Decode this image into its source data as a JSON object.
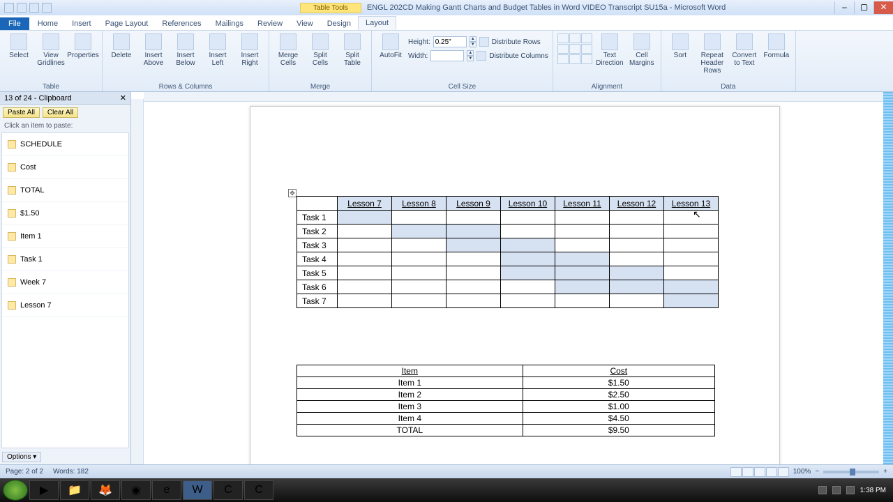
{
  "window": {
    "table_tools": "Table Tools",
    "title": "ENGL 202CD Making Gantt Charts and Budget Tables in Word VIDEO Transcript SU15a - Microsoft Word",
    "min": "–",
    "max": "▢",
    "close": "✕"
  },
  "tabs": {
    "file": "File",
    "items": [
      "Home",
      "Insert",
      "Page Layout",
      "References",
      "Mailings",
      "Review",
      "View",
      "Design",
      "Layout"
    ],
    "active": "Layout"
  },
  "ribbon": {
    "table": {
      "select": "Select",
      "gridlines": "View Gridlines",
      "properties": "Properties",
      "label": "Table"
    },
    "delete": {
      "delete": "Delete"
    },
    "rowscols": {
      "above": "Insert Above",
      "below": "Insert Below",
      "left": "Insert Left",
      "right": "Insert Right",
      "label": "Rows & Columns"
    },
    "merge": {
      "merge": "Merge Cells",
      "splitc": "Split Cells",
      "splitt": "Split Table",
      "label": "Merge"
    },
    "cellsize": {
      "autofit": "AutoFit",
      "height": "Height:",
      "width": "Width:",
      "hval": "0.25\"",
      "wval": "",
      "distr": "Distribute Rows",
      "distc": "Distribute Columns",
      "label": "Cell Size"
    },
    "alignment": {
      "textdir": "Text Direction",
      "margins": "Cell Margins",
      "label": "Alignment"
    },
    "data": {
      "sort": "Sort",
      "repeat": "Repeat Header Rows",
      "convert": "Convert to Text",
      "formula": "Formula",
      "label": "Data"
    }
  },
  "clipboard": {
    "header": "13 of 24 - Clipboard",
    "paste_all": "Paste All",
    "clear_all": "Clear All",
    "hint": "Click an item to paste:",
    "items": [
      "SCHEDULE",
      "Cost",
      "TOTAL",
      "$1.50",
      "Item 1",
      "Task 1",
      "Week 7",
      "Lesson 7"
    ],
    "options": "Options ▾"
  },
  "gantt": {
    "headers": [
      "",
      "Lesson 7",
      "Lesson 8",
      "Lesson 9",
      "Lesson 10",
      "Lesson 11",
      "Lesson 12",
      "Lesson 13"
    ],
    "rows": [
      "Task 1",
      "Task 2",
      "Task 3",
      "Task 4",
      "Task 5",
      "Task 6",
      "Task 7"
    ],
    "shaded": {
      "0": [
        0
      ],
      "1": [
        1,
        2
      ],
      "2": [
        2,
        3
      ],
      "3": [
        3,
        4
      ],
      "4": [
        3,
        4,
        5
      ],
      "5": [
        4,
        5,
        6
      ],
      "6": [
        6
      ]
    }
  },
  "budget": {
    "headers": [
      "Item",
      "Cost"
    ],
    "rows": [
      [
        "Item 1",
        "$1.50"
      ],
      [
        "Item 2",
        "$2.50"
      ],
      [
        "Item 3",
        "$1.00"
      ],
      [
        "Item 4",
        "$4.50"
      ],
      [
        "TOTAL",
        "$9.50"
      ]
    ]
  },
  "status": {
    "page": "Page: 2 of 2",
    "words": "Words: 182",
    "zoom": "100%"
  },
  "tray": {
    "time": "1:38 PM"
  },
  "chart_data": {
    "type": "table",
    "title": "Gantt schedule (shaded = task active in lesson)",
    "categories": [
      "Lesson 7",
      "Lesson 8",
      "Lesson 9",
      "Lesson 10",
      "Lesson 11",
      "Lesson 12",
      "Lesson 13"
    ],
    "series": [
      {
        "name": "Task 1",
        "values": [
          1,
          0,
          0,
          0,
          0,
          0,
          0
        ]
      },
      {
        "name": "Task 2",
        "values": [
          0,
          1,
          1,
          0,
          0,
          0,
          0
        ]
      },
      {
        "name": "Task 3",
        "values": [
          0,
          0,
          1,
          1,
          0,
          0,
          0
        ]
      },
      {
        "name": "Task 4",
        "values": [
          0,
          0,
          0,
          1,
          1,
          0,
          0
        ]
      },
      {
        "name": "Task 5",
        "values": [
          0,
          0,
          0,
          1,
          1,
          1,
          0
        ]
      },
      {
        "name": "Task 6",
        "values": [
          0,
          0,
          0,
          0,
          1,
          1,
          1
        ]
      },
      {
        "name": "Task 7",
        "values": [
          0,
          0,
          0,
          0,
          0,
          0,
          1
        ]
      }
    ]
  }
}
